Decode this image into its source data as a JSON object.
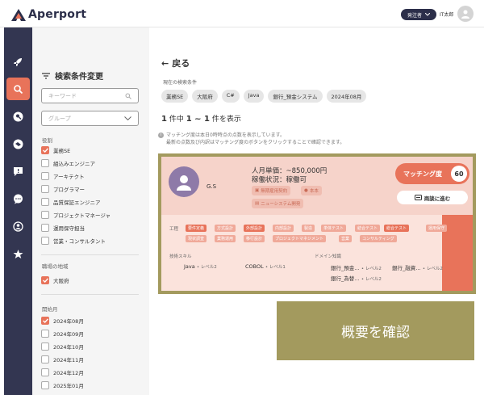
{
  "header": {
    "logo_text": "Aperport",
    "role_label": "発注者",
    "user_name": "IT太郎"
  },
  "sidebar": {
    "items": [
      {
        "icon": "rocket-icon"
      },
      {
        "icon": "search-icon",
        "active": true
      },
      {
        "icon": "person-search-icon"
      },
      {
        "icon": "handshake-icon"
      },
      {
        "icon": "message-alert-icon"
      },
      {
        "icon": "chat-icon"
      },
      {
        "icon": "team-icon"
      },
      {
        "icon": "star-icon"
      }
    ]
  },
  "filters": {
    "title": "検索条件変更",
    "keyword_placeholder": "キーワード",
    "group_placeholder": "グループ",
    "roles_label": "役割",
    "roles": [
      {
        "label": "業務SE",
        "checked": true
      },
      {
        "label": "組込みエンジニア",
        "checked": false
      },
      {
        "label": "アーキテクト",
        "checked": false
      },
      {
        "label": "プログラマー",
        "checked": false
      },
      {
        "label": "品質保証エンジニア",
        "checked": false
      },
      {
        "label": "プロジェクトマネージャ",
        "checked": false
      },
      {
        "label": "運用保守担当",
        "checked": false
      },
      {
        "label": "営業・コンサルタント",
        "checked": false
      }
    ],
    "area_label": "職場の地域",
    "areas": [
      {
        "label": "大阪府",
        "checked": true
      }
    ],
    "start_label": "開始月",
    "months": [
      {
        "label": "2024年08月",
        "checked": true
      },
      {
        "label": "2024年09月",
        "checked": false
      },
      {
        "label": "2024年10月",
        "checked": false
      },
      {
        "label": "2024年11月",
        "checked": false
      },
      {
        "label": "2024年12月",
        "checked": false
      },
      {
        "label": "2025年01月",
        "checked": false
      }
    ]
  },
  "main": {
    "back_label": "戻る",
    "current_label": "現在の検索条件",
    "chips": [
      "業務SE",
      "大阪府",
      "C#",
      "Java",
      "銀行_預金システム",
      "2024年08月"
    ],
    "count_prefix": "件中",
    "count_total": "1",
    "count_range": "1 ~ 1",
    "count_suffix": "件を表示",
    "notice_line1": "マッチング度は本日0時時点の点数を表示しています。",
    "notice_line2": "最新の点数及び内訳はマッチング度のボタンをクリックすることで確認できます。"
  },
  "card": {
    "name": "G.S",
    "price": "人月単価：~850,000円",
    "status": "稼働状況：稼働可",
    "tags": [
      "無期雇用契約",
      "本本",
      "ニューシステム開発"
    ],
    "match_label": "マッチング度",
    "match_score": "60",
    "negotiate_label": "商談に進む",
    "process_label": "工程",
    "processes": [
      {
        "label": "要件定義",
        "hl": true
      },
      {
        "label": "方式設計",
        "hl": false
      },
      {
        "label": "外部設計",
        "hl": true
      },
      {
        "label": "内部設計",
        "hl": false
      },
      {
        "label": "製造",
        "hl": false
      },
      {
        "label": "単体テスト",
        "hl": false
      },
      {
        "label": "結合テスト",
        "hl": false
      },
      {
        "label": "総合テスト",
        "hl": true
      },
      {
        "label": "運用保守",
        "hl": false
      },
      {
        "label": "現状調査",
        "hl": false
      },
      {
        "label": "業務運用",
        "hl": false
      },
      {
        "label": "移行設計",
        "hl": false
      },
      {
        "label": "プロジェクトマネジメント",
        "hl": false
      },
      {
        "label": "営業",
        "hl": false
      },
      {
        "label": "コンサルティング",
        "hl": false
      }
    ],
    "skill_label": "技術スキル",
    "domain_label": "ドメイン知識",
    "skills": [
      {
        "name": "Java",
        "level": "• レベル2"
      },
      {
        "name": "COBOL",
        "level": "• レベル1"
      }
    ],
    "domains": [
      {
        "name": "銀行_預金…",
        "level": "• レベル2"
      },
      {
        "name": "銀行_融資…",
        "level": "• レベル2"
      },
      {
        "name": "銀行_為替…",
        "level": "• レベル2"
      }
    ]
  },
  "overlay": {
    "confirm_label": "概要を確認"
  },
  "colors": {
    "accent": "#e8735a",
    "sidebar": "#333651",
    "olive": "#a39a5e"
  }
}
